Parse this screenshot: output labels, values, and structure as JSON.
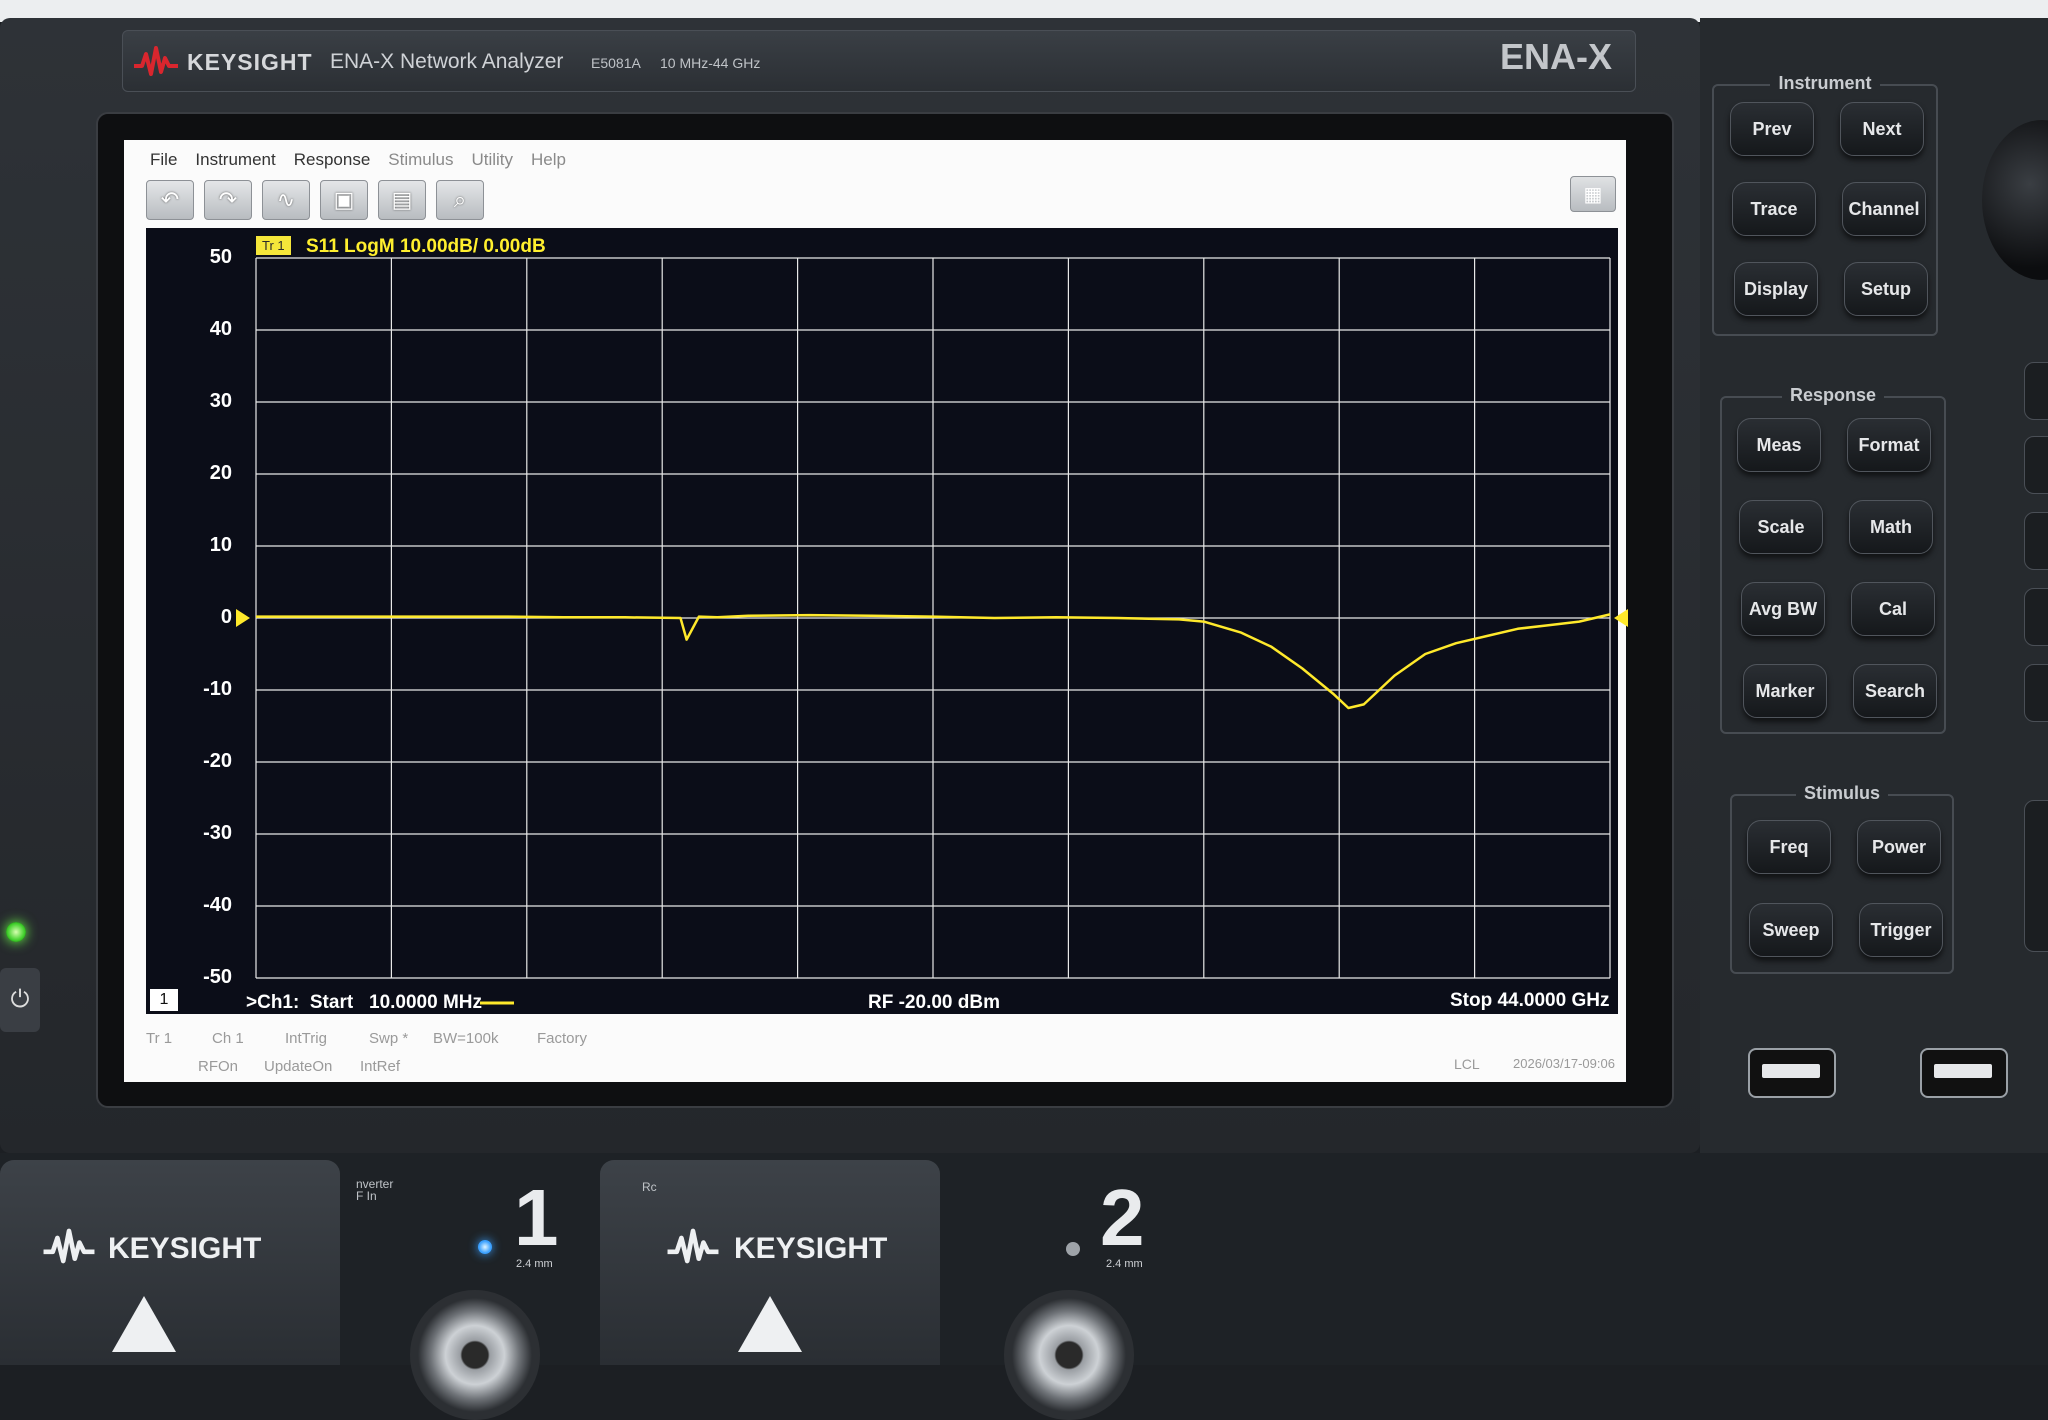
{
  "header": {
    "brand": "KEYSIGHT",
    "product": "ENA-X Network Analyzer",
    "model": "E5081A",
    "range": "10 MHz-44 GHz",
    "series": "ENA-X"
  },
  "menu": [
    "File",
    "Instrument",
    "Response",
    "Stimulus",
    "Utility",
    "Help"
  ],
  "toolbar": [
    {
      "name": "undo-icon",
      "glyph": "↶"
    },
    {
      "name": "redo-icon",
      "glyph": "↷"
    },
    {
      "name": "trace-icon",
      "glyph": "∿"
    },
    {
      "name": "screenshot-icon",
      "glyph": "▣"
    },
    {
      "name": "delete-icon",
      "glyph": "▤"
    },
    {
      "name": "zoom-icon",
      "glyph": "⌕"
    }
  ],
  "trace": {
    "tag": "Tr 1",
    "label": "S11 LogM 10.00dB/ 0.00dB",
    "color": "#ffe92b"
  },
  "footer": {
    "channel_badge": "1",
    "start": ">Ch1:  Start   10.0000 MHz",
    "rf": "RF  -20.00 dBm",
    "stop": "Stop  44.0000 GHz"
  },
  "status": {
    "row1": [
      "Tr 1",
      "Ch 1",
      "IntTrig",
      "Swp *",
      "BW=100k",
      "Factory"
    ],
    "row2": [
      "RFOn",
      "UpdateOn",
      "IntRef"
    ],
    "lcl": "LCL",
    "datetime": "2026/03/17-09:06"
  },
  "chart_data": {
    "type": "line",
    "title": "S11 LogM 10.00dB/ 0.00dB",
    "xlabel": "",
    "ylabel": "",
    "x_unit": "GHz",
    "xlim": [
      0.01,
      44.0
    ],
    "ylim": [
      -50,
      50
    ],
    "yticks": [
      50,
      40,
      30,
      20,
      10,
      0,
      -10,
      -20,
      -30,
      -40,
      -50
    ],
    "grid": true,
    "series": [
      {
        "x": [
          0.01,
          2,
          4,
          6,
          8,
          10,
          12,
          13.8,
          14.0,
          14.4,
          15,
          16,
          18,
          20,
          22,
          24,
          26,
          28,
          30,
          30.8,
          32,
          33,
          34,
          35,
          35.5,
          36,
          37,
          38,
          39,
          40,
          41,
          42,
          43,
          44.0
        ],
        "y": [
          0.2,
          0.2,
          0.2,
          0.2,
          0.2,
          0.1,
          0.1,
          0.0,
          -3.0,
          0.2,
          0.1,
          0.3,
          0.4,
          0.3,
          0.2,
          0.0,
          0.1,
          0.0,
          -0.2,
          -0.5,
          -2.0,
          -4.0,
          -7.0,
          -10.5,
          -12.5,
          -12.0,
          -8.0,
          -5.0,
          -3.5,
          -2.5,
          -1.5,
          -1.0,
          -0.5,
          0.5
        ],
        "color": "#ffe92b"
      }
    ],
    "reference_level": 0
  },
  "panel": {
    "instrument": {
      "title": "Instrument",
      "keys": [
        "Prev",
        "Next",
        "Trace",
        "Channel",
        "Display",
        "Setup"
      ]
    },
    "response": {
      "title": "Response",
      "keys": [
        "Meas",
        "Format",
        "Scale",
        "Math",
        "Avg BW",
        "Cal",
        "Marker",
        "Search"
      ]
    },
    "stimulus": {
      "title": "Stimulus",
      "keys": [
        "Freq",
        "Power",
        "Sweep",
        "Trigger"
      ]
    }
  },
  "ports": {
    "port1": "1",
    "port2": "2",
    "port_size": "2.4 mm",
    "cover_brand": "KEYSIGHT",
    "side_label_1": "nverter\nF In",
    "side_label_2": "Rc"
  }
}
